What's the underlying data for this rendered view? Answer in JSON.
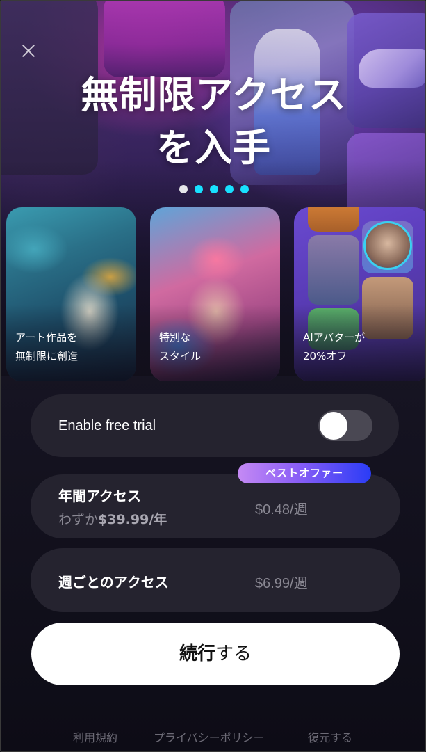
{
  "header": {
    "close_icon": "close-icon",
    "title_line1": "無制限アクセス",
    "title_line2": "を入手"
  },
  "carousel": {
    "page_count": 5,
    "active_index": 0,
    "active_color": "#e6e6ea",
    "inactive_color": "#18e0ff"
  },
  "features": [
    {
      "line1": "アート作品を",
      "line2": "無制限に創造"
    },
    {
      "line1": "特別な",
      "line2": "スタイル"
    },
    {
      "line1": "AIアバターが",
      "line2": "20%オフ"
    }
  ],
  "trial": {
    "label": "Enable free trial",
    "enabled": false
  },
  "plans": {
    "badge": "ベストオファー",
    "annual": {
      "title": "年間アクセス",
      "sub_prefix": "わずか",
      "sub_price": "$39.99/年",
      "price": "$0.48/週"
    },
    "weekly": {
      "title": "週ごとのアクセス",
      "price": "$6.99/週"
    }
  },
  "cta": {
    "bold": "続行",
    "rest": "する"
  },
  "footer": {
    "terms": "利用規約",
    "privacy": "プライバシーポリシー",
    "restore": "復元する"
  },
  "colors": {
    "card_bg": "#25232f",
    "badge_gradient_start": "#c58af4",
    "badge_gradient_end": "#2a3cf6",
    "cta_bg": "#ffffff"
  }
}
